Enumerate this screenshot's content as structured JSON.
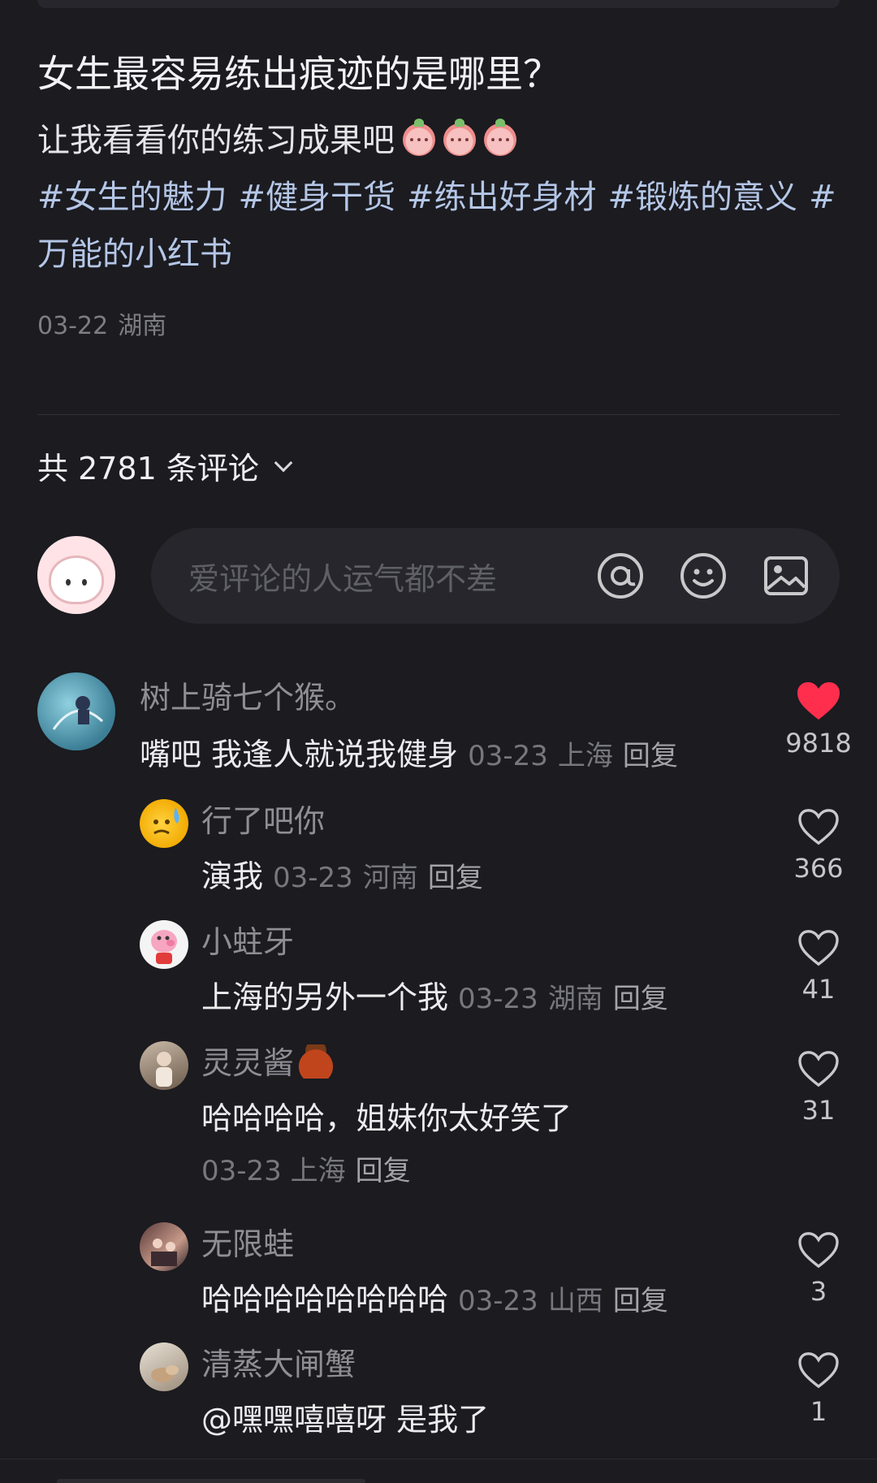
{
  "post": {
    "title": "女生最容易练出痕迹的是哪里？",
    "body": "让我看看你的练习成果吧",
    "emoji_icons": [
      "peach-face-icon",
      "peach-face-icon",
      "peach-face-icon"
    ],
    "hashtags": [
      "#女生的魅力",
      "#健身干货",
      "#练出好身材",
      "#锻炼的意义",
      "#万能的小红书"
    ],
    "date": "03-22",
    "location": "湖南"
  },
  "comments_header": {
    "label": "共 2781 条评论"
  },
  "composer": {
    "placeholder": "爱评论的人运气都不差",
    "icons": [
      "at-icon",
      "emoji-icon",
      "image-icon"
    ]
  },
  "comments": [
    {
      "name": "树上骑七个猴。",
      "text": "嘴吧 我逢人就说我健身",
      "date": "03-23",
      "location": "上海",
      "reply": "回复",
      "likes": "9818",
      "liked": true
    },
    {
      "name": "行了吧你",
      "text": "演我",
      "date": "03-23",
      "location": "河南",
      "reply": "回复",
      "likes": "366",
      "liked": false
    },
    {
      "name": "小蛀牙",
      "text": "上海的另外一个我",
      "date": "03-23",
      "location": "湖南",
      "reply": "回复",
      "likes": "41",
      "liked": false
    },
    {
      "name": "灵灵酱",
      "text": "哈哈哈哈，姐妹你太好笑了",
      "date": "03-23",
      "location": "上海",
      "reply": "回复",
      "likes": "31",
      "liked": false
    },
    {
      "name": "无限蛙",
      "text": "哈哈哈哈哈哈哈哈",
      "date": "03-23",
      "location": "山西",
      "reply": "回复",
      "likes": "3",
      "liked": false
    },
    {
      "name": "清蒸大闸蟹",
      "text": "@嘿嘿嘻嘻呀  是我了",
      "likes": "1",
      "liked": false
    }
  ],
  "colors": {
    "background": "#1b1b20",
    "hashtag": "#b4c6e6",
    "liked_heart": "#ff2e4d"
  }
}
